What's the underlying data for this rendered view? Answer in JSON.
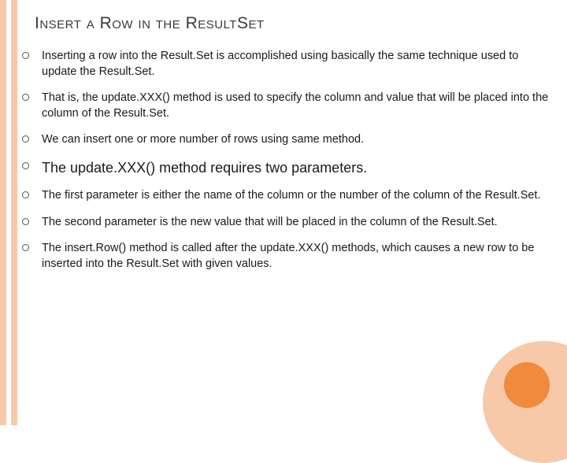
{
  "title": "Insert a Row in the ResultSet",
  "bullets": [
    {
      "text": "Inserting a row into the Result.Set is accomplished using basically the same technique used to update the Result.Set.",
      "emph": false
    },
    {
      "text": "That is, the update.XXX() method is used to specify the column and value that will be placed into the column of the Result.Set.",
      "emph": false
    },
    {
      "text": "We can insert one or more number of rows using same method.",
      "emph": false
    },
    {
      "text": "The update.XXX() method requires two parameters.",
      "emph": true
    },
    {
      "text": "The first parameter is either the name of the column or the number of the column of the Result.Set.",
      "emph": false
    },
    {
      "text": "The second parameter is the new value that will be placed in the column of the Result.Set.",
      "emph": false
    },
    {
      "text": "The insert.Row() method is called after the update.XXX() methods, which causes a new row to be inserted into the Result.Set with given values.",
      "emph": false
    }
  ]
}
